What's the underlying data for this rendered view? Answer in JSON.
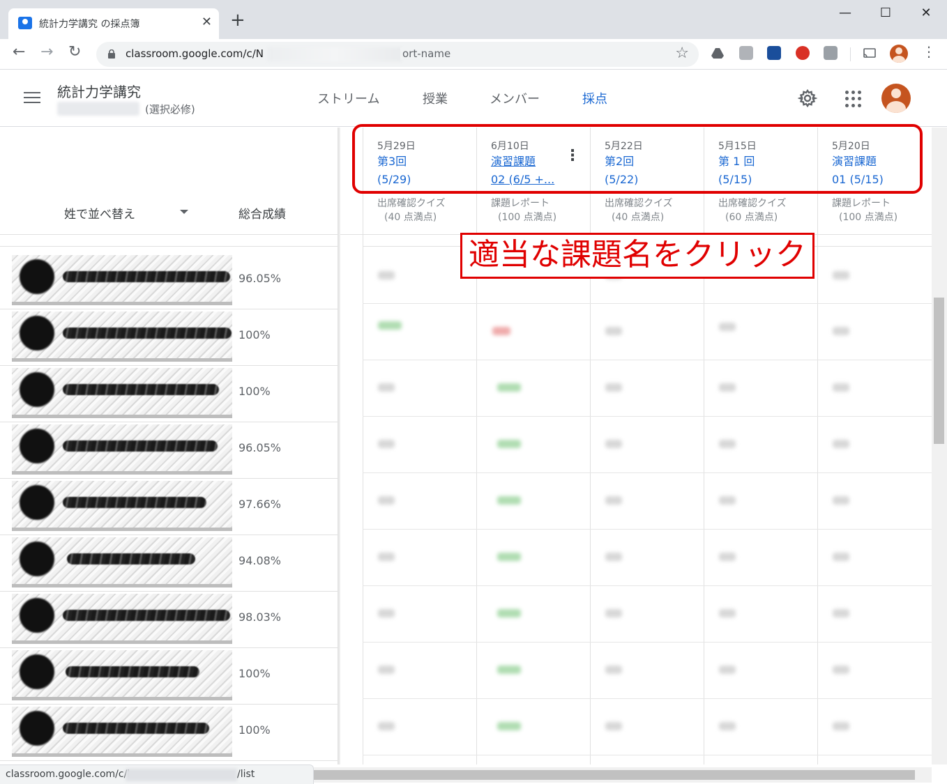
{
  "browser": {
    "tab_title": "統計力学講究 の採点簿",
    "tab_close": "✕",
    "new_tab": "+",
    "window_controls": {
      "minimize": "—",
      "maximize": "☐",
      "close": "✕"
    },
    "nav": {
      "back": "←",
      "forward": "→",
      "reload": "↻"
    },
    "url_prefix": "classroom.google.com/c/N",
    "url_suffix": "ort-name",
    "star": "☆",
    "menu": "⋮",
    "status_prefix": "classroom.google.com/c/l",
    "status_suffix": "/list"
  },
  "header": {
    "menu_icon": "hamburger-icon",
    "class_name": "統計力学講究",
    "class_section_suffix": "(選択必修)",
    "tabs": [
      {
        "label": "ストリーム",
        "active": false
      },
      {
        "label": "授業",
        "active": false
      },
      {
        "label": "メンバー",
        "active": false
      },
      {
        "label": "採点",
        "active": true
      }
    ],
    "accent_color": "#1967d2"
  },
  "gradebook": {
    "sort_label": "姓で並べ替え",
    "overall_label": "総合成績",
    "assignments": [
      {
        "date": "5月29日",
        "title_lines": [
          "第3回",
          "(5/29)"
        ],
        "type": "出席確認クイズ",
        "points": "(40 点満点)",
        "linked": false
      },
      {
        "date": "6月10日",
        "title_lines": [
          "演習課題",
          "02 (6/5 +..."
        ],
        "type": "課題レポート",
        "points": "(100 点満点)",
        "linked": true,
        "menu": "⋮"
      },
      {
        "date": "5月22日",
        "title_lines": [
          "第2回",
          "(5/22)"
        ],
        "type": "出席確認クイズ",
        "points": "(40 点満点)",
        "linked": false
      },
      {
        "date": "5月15日",
        "title_lines": [
          "第 1 回",
          "(5/15)"
        ],
        "type": "出席確認クイズ",
        "points": "(60 点満点)",
        "linked": false
      },
      {
        "date": "5月20日",
        "title_lines": [
          "演習課題",
          "01 (5/15)"
        ],
        "type": "課題レポート",
        "points": "(100 点満点)",
        "linked": false
      }
    ],
    "students": [
      {
        "overall": "96.05%"
      },
      {
        "overall": "100%"
      },
      {
        "overall": "100%"
      },
      {
        "overall": "96.05%"
      },
      {
        "overall": "97.66%"
      },
      {
        "overall": "94.08%"
      },
      {
        "overall": "98.03%"
      },
      {
        "overall": "100%"
      },
      {
        "overall": "100%"
      }
    ]
  },
  "annotation": {
    "label": "適当な課題名をクリック",
    "color": "#e00000"
  }
}
